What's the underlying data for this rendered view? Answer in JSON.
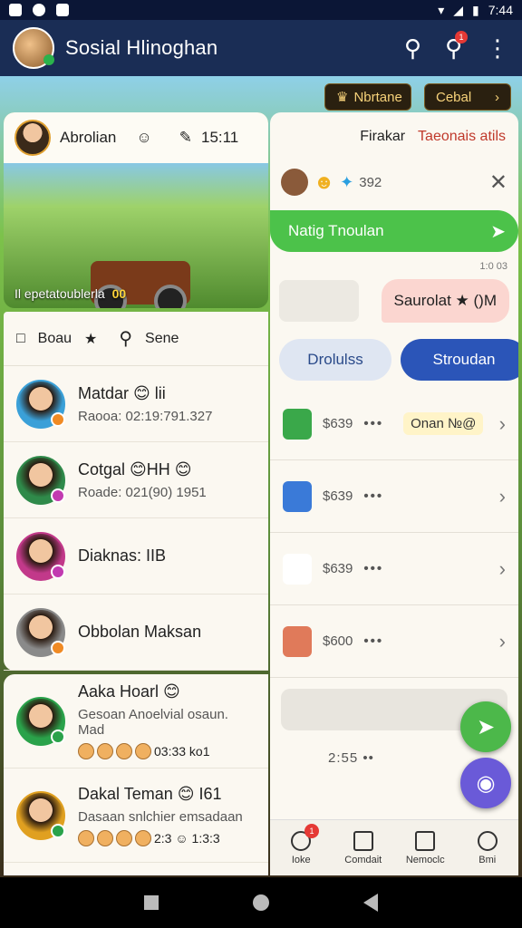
{
  "status_bar": {
    "time": "7:44"
  },
  "app_bar": {
    "title": "Sosial Hlinoghan",
    "notification_count": "1"
  },
  "top_pills": {
    "left": "Nbrtane",
    "right": "Cebal"
  },
  "feature_card": {
    "user_name": "Abrolian",
    "time": "15:11",
    "caption": "Il epetatoublerla",
    "score": "00"
  },
  "toolbar": {
    "filter_label": "Boau",
    "search_label": "Sene"
  },
  "contacts": [
    {
      "name": "Matdar 😊 lii",
      "sub": "Raooa: 02:19:791.327",
      "color": "#3aa0d8",
      "dot": "#f08a24"
    },
    {
      "name": "Cotgal 😊HH 😊",
      "sub": "Roade: 021(90) 1951",
      "color": "#2f8a4a",
      "dot": "#c23ab0"
    },
    {
      "name": "Diaknas: IIB",
      "sub": "",
      "color": "#c2398a",
      "dot": "#c23ab0"
    },
    {
      "name": "Obbolan Maksan",
      "sub": "",
      "color": "#8a8a8a",
      "dot": "#f08a24"
    }
  ],
  "contacts2": [
    {
      "name": "Aaka Hoarl 😊",
      "sub": "Gesoan Anoelvial osaun. Mad",
      "meta": "03:33   ko1",
      "color": "#2aa24a",
      "dot": "#2aa24a"
    },
    {
      "name": "Dakal Teman 😊 I61",
      "sub": "Dasaan snlchier emsadaan",
      "meta": "2:3  ☺ 1:3:3",
      "color": "#e0a020",
      "dot": "#2aa24a"
    }
  ],
  "chat": {
    "header_name": "Firakar",
    "header_link": "Taeonais atils",
    "participant_info": "392",
    "green_message": "Natig Tnoulan",
    "green_time": "1:0 03",
    "pink_message": "Saurolat ★ ()M",
    "button_light": "Drolulss",
    "button_blue": "Stroudan",
    "items": [
      {
        "price": "$639",
        "tag": "Onan №@",
        "icon_color": "#3aa84a"
      },
      {
        "price": "$639",
        "tag": "",
        "icon_color": "#3a7ad8"
      },
      {
        "price": "$639",
        "tag": "",
        "icon_color": "#ffffff"
      },
      {
        "price": "$600",
        "tag": "",
        "icon_color": "#e07a5a"
      }
    ],
    "gray_bar_text": "--",
    "bottom_time": "2:55  ••"
  },
  "bottom_nav": {
    "tabs": [
      "Ioke",
      "Comdait",
      "Nemoclc",
      "Bmi"
    ],
    "badge": "1"
  }
}
